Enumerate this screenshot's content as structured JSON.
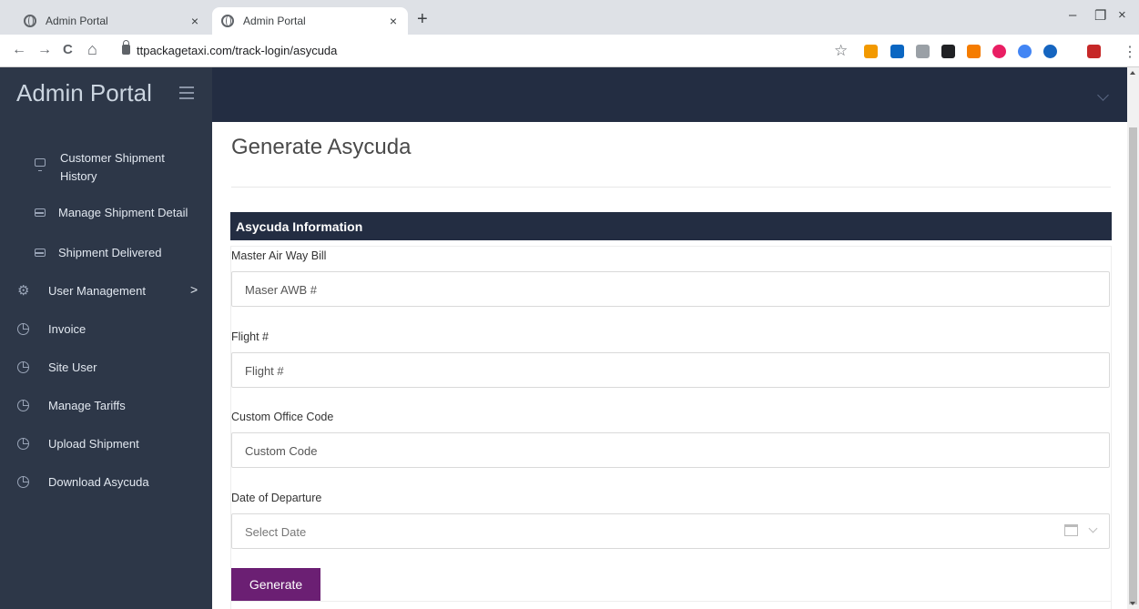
{
  "browser": {
    "tabs": [
      {
        "title": "Admin Portal",
        "close": "×"
      },
      {
        "title": "Admin Portal",
        "close": "×"
      }
    ],
    "new_tab": "+",
    "window_controls": {
      "minimize": "–",
      "restore": "❐",
      "close": "×"
    },
    "nav": {
      "back": "←",
      "forward": "→",
      "reload": "C",
      "home": "⌂"
    },
    "url": "ttpackagetaxi.com/track-login/asycuda",
    "bookmark_icon": "☆",
    "menu_icon": "⋮",
    "extension_colors": [
      "#f29900",
      "#0a66c2",
      "#9aa0a6",
      "#202124",
      "#f57c00",
      "#e91e63",
      "#4285f4",
      "#1565c0",
      "#c62828"
    ]
  },
  "app": {
    "brand": "Admin Portal",
    "sidebar": [
      {
        "label": "Customer Shipment History",
        "icon": "monitor-icon"
      },
      {
        "label": "Manage Shipment Detail",
        "icon": "card-icon"
      },
      {
        "label": "Shipment Delivered",
        "icon": "card-icon"
      },
      {
        "label": "User Management",
        "icon": "gear-icon",
        "chevron": ">"
      },
      {
        "label": "Invoice",
        "icon": "clock-icon"
      },
      {
        "label": "Site User",
        "icon": "clock-icon"
      },
      {
        "label": "Manage Tariffs",
        "icon": "clock-icon"
      },
      {
        "label": "Upload Shipment",
        "icon": "clock-icon"
      },
      {
        "label": "Download Asycuda",
        "icon": "clock-icon"
      }
    ]
  },
  "page": {
    "title": "Generate Asycuda",
    "card_title": "Asycuda Information",
    "fields": [
      {
        "label": "Master Air Way Bill",
        "placeholder": "Maser AWB #"
      },
      {
        "label": "Flight #",
        "placeholder": "Flight #"
      },
      {
        "label": "Custom Office Code",
        "placeholder": "Custom Code"
      },
      {
        "label": "Date of Departure",
        "placeholder": "Select Date"
      }
    ],
    "submit_label": "Generate"
  },
  "colors": {
    "sidebar_bg": "#2d3748",
    "header_bg": "#232d42",
    "button_bg": "#6b1f73"
  }
}
